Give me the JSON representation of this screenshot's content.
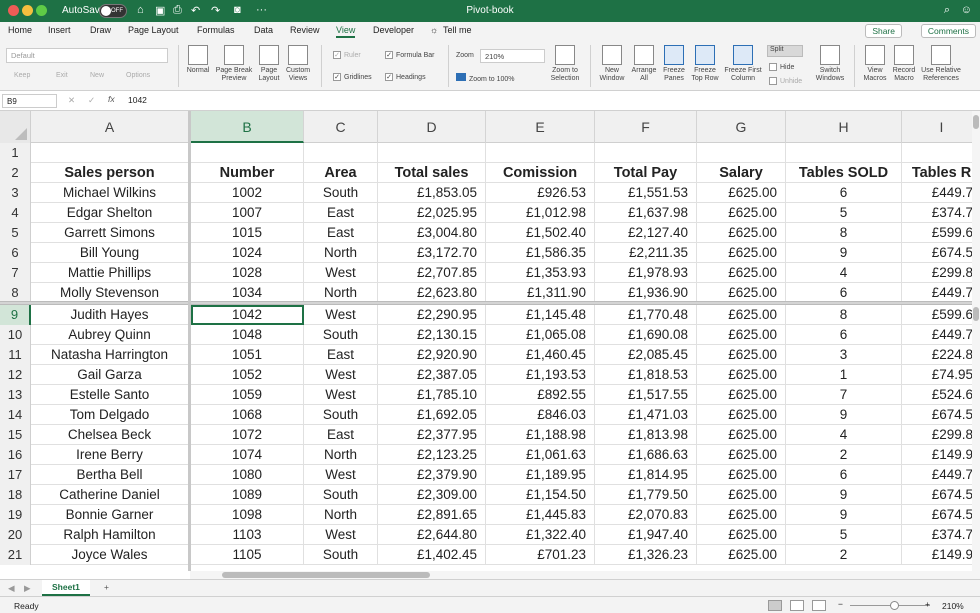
{
  "titlebar": {
    "autosave": "AutoSave",
    "autosave_state": "OFF",
    "title": "Pivot-book"
  },
  "tabs": [
    {
      "label": "Home"
    },
    {
      "label": "Insert"
    },
    {
      "label": "Draw"
    },
    {
      "label": "Page Layout"
    },
    {
      "label": "Formulas"
    },
    {
      "label": "Data"
    },
    {
      "label": "Review"
    },
    {
      "label": "View"
    },
    {
      "label": "Developer"
    },
    {
      "label": "Tell me"
    }
  ],
  "tab_share": "Share",
  "tab_comments": "Comments",
  "ribbon": {
    "view_select": "Default",
    "keep": "Keep",
    "exit": "Exit",
    "new": "New",
    "options": "Options",
    "normal": "Normal",
    "page_break": "Page Break Preview",
    "page_layout": "Page Layout",
    "custom_views": "Custom Views",
    "ruler": "Ruler",
    "formula_bar": "Formula Bar",
    "gridlines": "Gridlines",
    "headings": "Headings",
    "zoom_label": "Zoom",
    "zoom_value": "210%",
    "zoom_100": "Zoom to 100%",
    "zoom_selection": "Zoom to Selection",
    "new_window": "New Window",
    "arrange_all": "Arrange All",
    "freeze_panes": "Freeze Panes",
    "freeze_top": "Freeze Top Row",
    "freeze_first": "Freeze First Column",
    "split": "Split",
    "hide": "Hide",
    "unhide": "Unhide",
    "switch_windows": "Switch Windows",
    "view_macros": "View Macros",
    "record_macro": "Record Macro",
    "relative_refs": "Use Relative References"
  },
  "formula": {
    "namebox": "B9",
    "fx": "fx",
    "value": "1042"
  },
  "columns": [
    "A",
    "B",
    "C",
    "D",
    "E",
    "F",
    "G",
    "H",
    "I"
  ],
  "header_row": [
    "Sales person",
    "Number",
    "Area",
    "Total sales",
    "Comission",
    "Total Pay",
    "Salary",
    "Tables SOLD",
    "Tables R"
  ],
  "rows": [
    [
      "Michael Wilkins",
      "1002",
      "South",
      "£1,853.05",
      "£926.53",
      "£1,551.53",
      "£625.00",
      "6",
      "£449.7"
    ],
    [
      "Edgar Shelton",
      "1007",
      "East",
      "£2,025.95",
      "£1,012.98",
      "£1,637.98",
      "£625.00",
      "5",
      "£374.7"
    ],
    [
      "Garrett Simons",
      "1015",
      "East",
      "£3,004.80",
      "£1,502.40",
      "£2,127.40",
      "£625.00",
      "8",
      "£599.6"
    ],
    [
      "Bill Young",
      "1024",
      "North",
      "£3,172.70",
      "£1,586.35",
      "£2,211.35",
      "£625.00",
      "9",
      "£674.5"
    ],
    [
      "Mattie Phillips",
      "1028",
      "West",
      "£2,707.85",
      "£1,353.93",
      "£1,978.93",
      "£625.00",
      "4",
      "£299.8"
    ],
    [
      "Molly Stevenson",
      "1034",
      "North",
      "£2,623.80",
      "£1,311.90",
      "£1,936.90",
      "£625.00",
      "6",
      "£449.7"
    ],
    [
      "Judith Hayes",
      "1042",
      "West",
      "£2,290.95",
      "£1,145.48",
      "£1,770.48",
      "£625.00",
      "8",
      "£599.6"
    ],
    [
      "Aubrey Quinn",
      "1048",
      "South",
      "£2,130.15",
      "£1,065.08",
      "£1,690.08",
      "£625.00",
      "6",
      "£449.7"
    ],
    [
      "Natasha Harrington",
      "1051",
      "East",
      "£2,920.90",
      "£1,460.45",
      "£2,085.45",
      "£625.00",
      "3",
      "£224.8"
    ],
    [
      "Gail Garza",
      "1052",
      "West",
      "£2,387.05",
      "£1,193.53",
      "£1,818.53",
      "£625.00",
      "1",
      "£74.95"
    ],
    [
      "Estelle Santo",
      "1059",
      "West",
      "£1,785.10",
      "£892.55",
      "£1,517.55",
      "£625.00",
      "7",
      "£524.6"
    ],
    [
      "Tom Delgado",
      "1068",
      "South",
      "£1,692.05",
      "£846.03",
      "£1,471.03",
      "£625.00",
      "9",
      "£674.5"
    ],
    [
      "Chelsea Beck",
      "1072",
      "East",
      "£2,377.95",
      "£1,188.98",
      "£1,813.98",
      "£625.00",
      "4",
      "£299.8"
    ],
    [
      "Irene Berry",
      "1074",
      "North",
      "£2,123.25",
      "£1,061.63",
      "£1,686.63",
      "£625.00",
      "2",
      "£149.9"
    ],
    [
      "Bertha Bell",
      "1080",
      "West",
      "£2,379.90",
      "£1,189.95",
      "£1,814.95",
      "£625.00",
      "6",
      "£449.7"
    ],
    [
      "Catherine Daniel",
      "1089",
      "South",
      "£2,309.00",
      "£1,154.50",
      "£1,779.50",
      "£625.00",
      "9",
      "£674.5"
    ],
    [
      "Bonnie Garner",
      "1098",
      "North",
      "£2,891.65",
      "£1,445.83",
      "£2,070.83",
      "£625.00",
      "9",
      "£674.5"
    ],
    [
      "Ralph Hamilton",
      "1103",
      "West",
      "£2,644.80",
      "£1,322.40",
      "£1,947.40",
      "£625.00",
      "5",
      "£374.7"
    ],
    [
      "Joyce Wales",
      "1105",
      "South",
      "£1,402.45",
      "£701.23",
      "£1,326.23",
      "£625.00",
      "2",
      "£149.9"
    ]
  ],
  "sheet": {
    "name": "Sheet1",
    "add": "+"
  },
  "status": {
    "ready": "Ready",
    "zoom": "210%"
  }
}
